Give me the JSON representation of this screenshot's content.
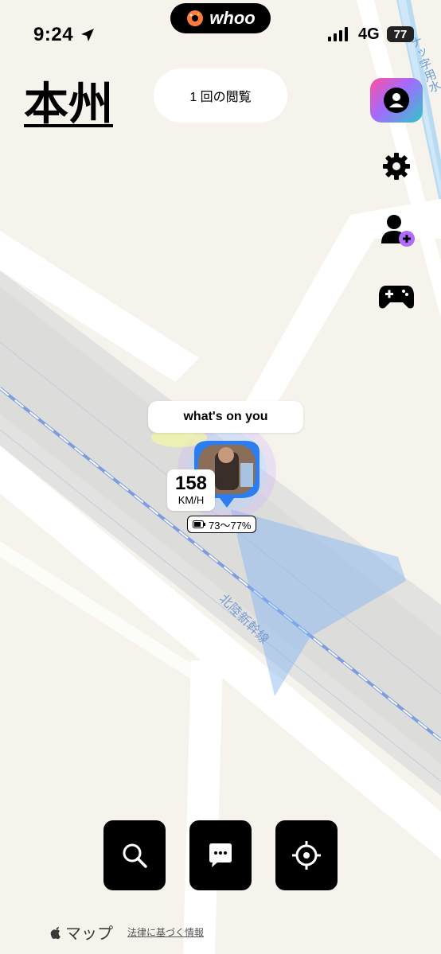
{
  "status_bar": {
    "time": "9:24",
    "network": "4G",
    "battery": "77"
  },
  "app": {
    "logo_text": "whoo"
  },
  "header": {
    "region_name": "本州",
    "view_count": "1 回の閲覧"
  },
  "side_buttons": [
    "profile-icon",
    "gear-icon",
    "add-friend-icon",
    "game-controller-icon"
  ],
  "marker": {
    "status_text": "what's on you",
    "speed": "158",
    "speed_unit": "KM/H",
    "battery_range": "73〜77%"
  },
  "map_labels": {
    "rail_line": "北陸新幹線",
    "river": "ナッ字用水"
  },
  "bottom_buttons": [
    "search-icon",
    "chat-icon",
    "locate-icon"
  ],
  "footer": {
    "maps_label": "マップ",
    "legal_link": "法律に基づく情報"
  },
  "colors": {
    "accent_gradient": [
      "#ff4fa0",
      "#a36bff",
      "#2fc7c9"
    ],
    "marker_blue": "#2b7df0"
  }
}
